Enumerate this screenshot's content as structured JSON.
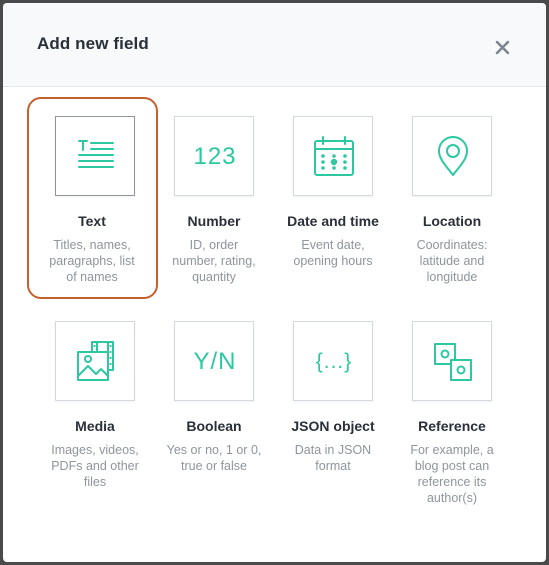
{
  "dialog": {
    "title": "Add new field",
    "close_icon": "close-icon"
  },
  "colors": {
    "accent": "#2dc8a2",
    "selection": "#c4602f",
    "title": "#2a3039",
    "description": "#8e959c"
  },
  "fields": [
    {
      "key": "text",
      "label": "Text",
      "desc": [
        "Titles, names,",
        "paragraphs, list",
        "of names"
      ],
      "icon": "text-icon",
      "selected": true
    },
    {
      "key": "number",
      "label": "Number",
      "desc": [
        "ID, order",
        "number, rating,",
        "quantity"
      ],
      "icon": "number-icon",
      "glyph": "123",
      "selected": false
    },
    {
      "key": "date",
      "label": "Date and time",
      "desc": [
        "Event date,",
        "opening hours"
      ],
      "icon": "calendar-icon",
      "selected": false
    },
    {
      "key": "location",
      "label": "Location",
      "desc": [
        "Coordinates:",
        "latitude and",
        "longitude"
      ],
      "icon": "map-pin-icon",
      "selected": false
    },
    {
      "key": "media",
      "label": "Media",
      "desc": [
        "Images, videos,",
        "PDFs and other",
        "files"
      ],
      "icon": "media-icon",
      "selected": false
    },
    {
      "key": "boolean",
      "label": "Boolean",
      "desc": [
        "Yes or no, 1 or 0,",
        "true or false"
      ],
      "icon": "boolean-icon",
      "glyph": "Y/N",
      "selected": false
    },
    {
      "key": "json",
      "label": "JSON object",
      "desc": [
        "Data in JSON",
        "format"
      ],
      "icon": "json-braces-icon",
      "glyph": "{...}",
      "selected": false
    },
    {
      "key": "reference",
      "label": "Reference",
      "desc": [
        "For example, a",
        "blog post can",
        "reference its",
        "author(s)"
      ],
      "icon": "reference-icon",
      "selected": false
    }
  ]
}
